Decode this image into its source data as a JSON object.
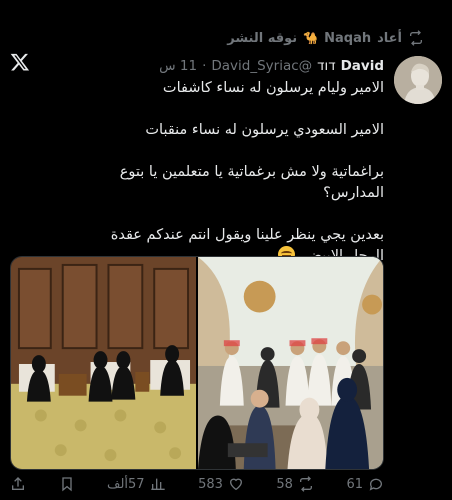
{
  "repost": {
    "label": "أعاد",
    "name": "Naqah",
    "camel": "🐪",
    "subtitle": "نوقه النشر"
  },
  "tweet": {
    "author_name": "David",
    "author_script": "דוד",
    "handle": "@David_Syriac",
    "time": "11 س",
    "dot": "·",
    "lines": [
      "الامير وليام يرسلون له نساء كاشفات",
      "",
      "الامير السعودي يرسلون له نساء منقبات",
      "",
      "براغماتية ولا مش برغماتية يا متعلمين يا بتوع المدارس؟",
      "",
      "بعدين يجي ينظر علينا ويقول انتم عندكم عقدة الرجل الابيض."
    ]
  },
  "actions": {
    "replies": "61",
    "reposts": "58",
    "likes": "583",
    "views": "57ألف"
  },
  "colors": {
    "background": "#000000",
    "text": "#e7e9ea",
    "muted": "#71767b",
    "border": "#2f3336"
  },
  "icons": [
    "x-logo-icon",
    "repost-icon",
    "reply-icon",
    "like-icon",
    "views-icon",
    "bookmark-icon",
    "share-icon"
  ]
}
